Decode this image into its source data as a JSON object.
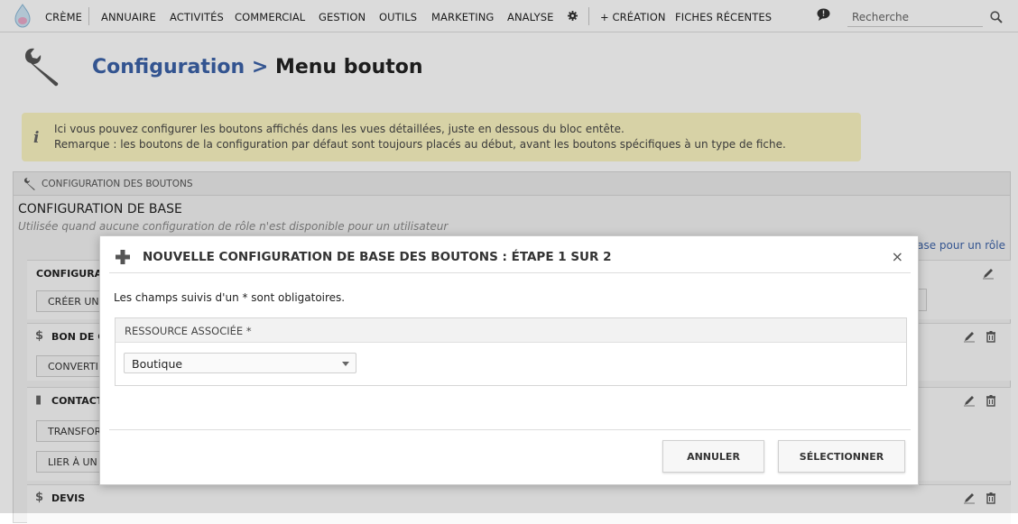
{
  "nav": {
    "brand": "Crème",
    "items": [
      "Annuaire",
      "Activités",
      "Commercial",
      "Gestion",
      "Outils",
      "Marketing",
      "Analyse"
    ],
    "creation": "+ Création",
    "recent": "Fiches récentes",
    "search_placeholder": "Recherche"
  },
  "page": {
    "breadcrumb": "Configuration",
    "separator": ">",
    "title": "Menu bouton"
  },
  "info": {
    "line1": "Ici vous pouvez configurer les boutons affichés dans les vues détaillées, juste en dessous du bloc entête.",
    "line2": "Remarque : les boutons de la configuration par défaut sont toujours placés au début, avant les boutons spécifiques à un type de fiche."
  },
  "block": {
    "header": "Configuration des boutons",
    "base_title": "Configuration de base",
    "base_desc": "Utilisée quand aucune configuration de rôle n'est disponible pour un utilisateur",
    "role_link": "ase pour un rôle",
    "rows": [
      {
        "label": "Configurat",
        "buttons": [
          "Créer une"
        ]
      },
      {
        "label": "Bon de co",
        "icon": "$",
        "buttons": [
          "Converti"
        ]
      },
      {
        "label": "Contact",
        "icon": "▮",
        "buttons": [
          "Transfor",
          "Lier à un"
        ]
      },
      {
        "label": "Devis",
        "icon": "$",
        "buttons": []
      }
    ]
  },
  "modal": {
    "title": "Nouvelle configuration de base des boutons : Étape 1 sur 2",
    "close": "×",
    "required_note": "Les champs suivis d'un * sont obligatoires.",
    "field_label": "Ressource associée *",
    "select_value": "Boutique",
    "cancel": "Annuler",
    "submit": "Sélectionner"
  }
}
